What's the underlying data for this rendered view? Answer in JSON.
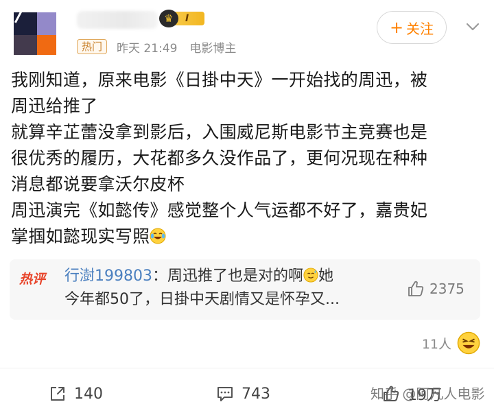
{
  "author": {
    "hot_tag": "热门",
    "time": "昨天 21:49",
    "verification": "电影博主",
    "level_badge": "I"
  },
  "follow_button": {
    "label": "关注",
    "plus": "+"
  },
  "post": {
    "lines": [
      "我刚知道，原来电影《日掛中天》一开始找的周迅，被",
      "周迅给推了",
      "就算辛芷蕾没拿到影后，入围威尼斯电影节主竞赛也是",
      "很优秀的履历，大花都多久没作品了，更何况现在种种",
      "消息都说要拿沃尔皮杯",
      "周迅演完《如懿传》感觉整个人气运都不好了，嘉贵妃",
      "掌掴如懿现实写照"
    ]
  },
  "hot_comment": {
    "label": "热评",
    "username": "行澍199803",
    "separator": "：",
    "line1": "周迅推了也是对的啊",
    "line1_end": "她",
    "line2": "今年都50了，日掛中天剧情又是怀孕又...",
    "likes": "2375"
  },
  "reactions": {
    "count": "11人"
  },
  "actions": {
    "share": "140",
    "comments": "743",
    "likes": "19万"
  },
  "watermark": "知乎 @阿凡人电影",
  "colors": {
    "accent_orange": "#ff8200",
    "hot_red": "#e8452b",
    "link_blue": "#4a7fbf"
  }
}
